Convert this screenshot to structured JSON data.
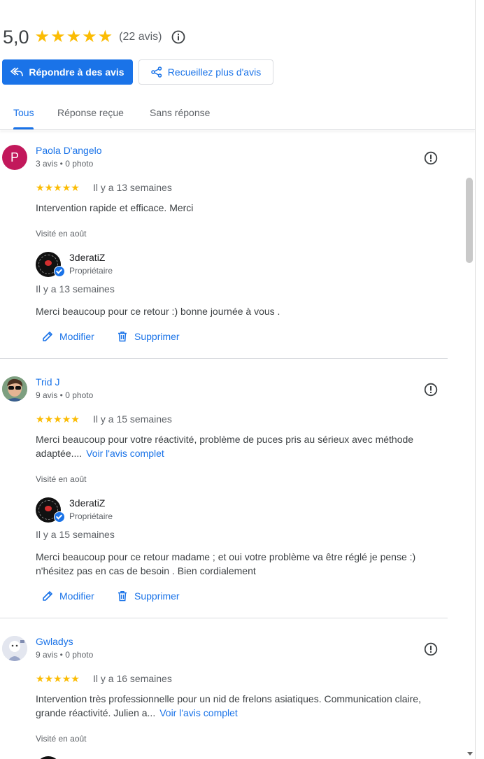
{
  "summary": {
    "rating": "5,0",
    "count_label": "(22 avis)",
    "stars": 5
  },
  "actions": {
    "reply_label": "Répondre à des avis",
    "collect_label": "Recueillez plus d'avis"
  },
  "tabs": [
    {
      "label": "Tous",
      "active": true
    },
    {
      "label": "Réponse reçue",
      "active": false
    },
    {
      "label": "Sans réponse",
      "active": false
    }
  ],
  "reviews": [
    {
      "name": "Paola D'angelo",
      "avatar_letter": "P",
      "meta": "3 avis • 0 photo",
      "stars": 5,
      "date": "Il y a 13 semaines",
      "text": "Intervention rapide et efficace. Merci",
      "more": "",
      "visited": "Visité en août",
      "reply": {
        "owner": "3deratiZ",
        "role": "Propriétaire",
        "date": "Il y a 13 semaines",
        "text": "Merci beaucoup pour ce retour :) bonne journée à vous ."
      },
      "edit_label": "Modifier",
      "delete_label": "Supprimer"
    },
    {
      "name": "Trid J",
      "avatar_letter": "",
      "meta": "9 avis • 0 photo",
      "stars": 5,
      "date": "Il y a 15 semaines",
      "text": "Merci beaucoup pour votre réactivité, problème de puces pris au sérieux avec méthode adaptée....",
      "more": "Voir l'avis complet",
      "visited": "Visité en août",
      "reply": {
        "owner": "3deratiZ",
        "role": "Propriétaire",
        "date": "Il y a 15 semaines",
        "text": "Merci beaucoup pour ce retour madame ; et oui votre problème va être réglé je pense :) n'hésitez pas en cas de besoin . Bien cordialement"
      },
      "edit_label": "Modifier",
      "delete_label": "Supprimer"
    },
    {
      "name": "Gwladys",
      "avatar_letter": "",
      "meta": "9 avis • 0 photo",
      "stars": 5,
      "date": "Il y a 16 semaines",
      "text": "Intervention très professionnelle pour un nid de frelons asiatiques. Communication claire, grande réactivité. Julien a...",
      "more": "Voir l'avis complet",
      "visited": "Visité en août"
    }
  ],
  "colors": {
    "accent": "#1a73e8",
    "star": "#fbbc04",
    "avatar_p": "#c2185b"
  }
}
